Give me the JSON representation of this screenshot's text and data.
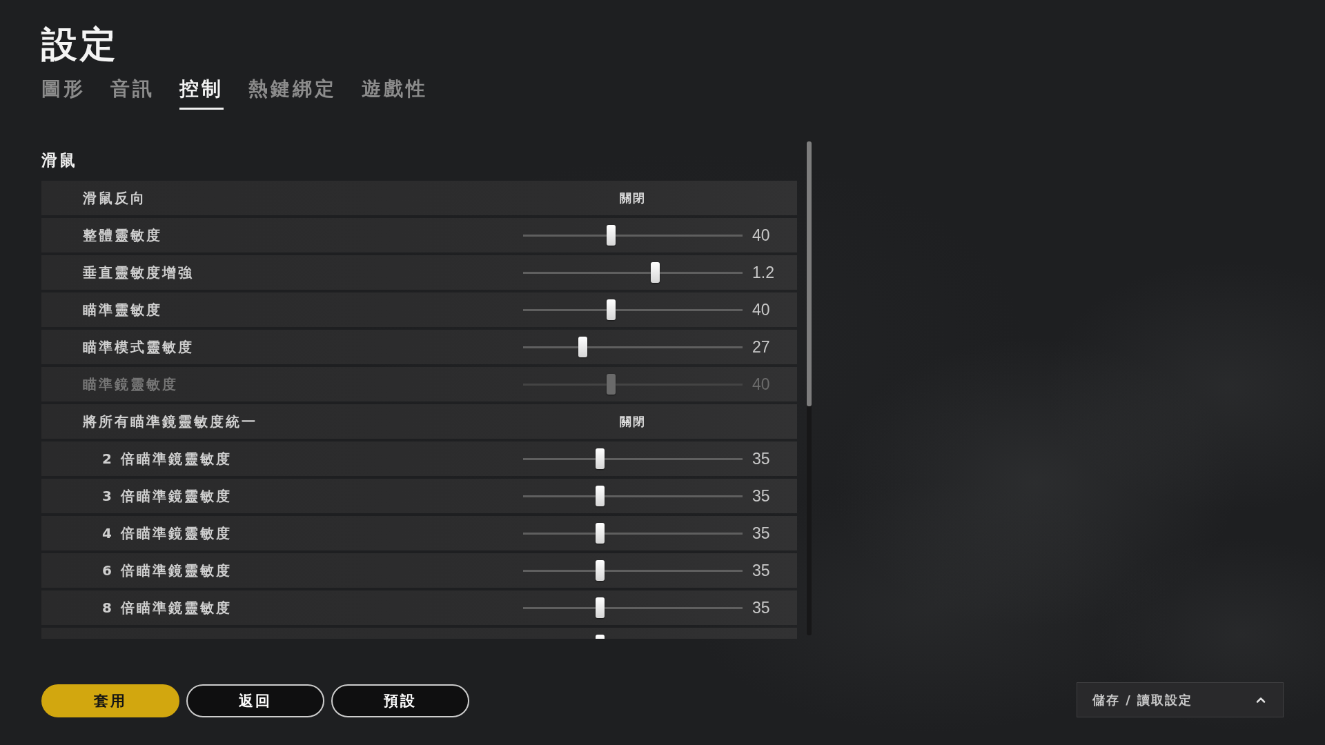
{
  "title": "設定",
  "tabs": [
    {
      "label": "圖形",
      "selected": false
    },
    {
      "label": "音訊",
      "selected": false
    },
    {
      "label": "控制",
      "selected": true
    },
    {
      "label": "熱鍵綁定",
      "selected": false
    },
    {
      "label": "遊戲性",
      "selected": false
    }
  ],
  "section": {
    "title": "滑鼠",
    "rows": [
      {
        "kind": "toggle",
        "label": "滑鼠反向",
        "value": "關閉",
        "disabled": false
      },
      {
        "kind": "slider",
        "label": "整體靈敏度",
        "level": 0.4,
        "value": "40",
        "disabled": false
      },
      {
        "kind": "slider",
        "label": "垂直靈敏度增強",
        "level": 0.6,
        "value": "1.2",
        "disabled": false
      },
      {
        "kind": "slider",
        "label": "瞄準靈敏度",
        "level": 0.4,
        "value": "40",
        "disabled": false
      },
      {
        "kind": "slider",
        "label": "瞄準模式靈敏度",
        "level": 0.27,
        "value": "27",
        "disabled": false
      },
      {
        "kind": "slider",
        "label": "瞄準鏡靈敏度",
        "level": 0.4,
        "value": "40",
        "disabled": true
      },
      {
        "kind": "toggle",
        "label": "將所有瞄準鏡靈敏度統一",
        "value": "關閉",
        "disabled": false,
        "children": [
          {
            "kind": "slider",
            "label": "2 倍瞄準鏡靈敏度",
            "level": 0.35,
            "value": "35",
            "disabled": false
          },
          {
            "kind": "slider",
            "label": "3 倍瞄準鏡靈敏度",
            "level": 0.35,
            "value": "35",
            "disabled": false
          },
          {
            "kind": "slider",
            "label": "4 倍瞄準鏡靈敏度",
            "level": 0.35,
            "value": "35",
            "disabled": false
          },
          {
            "kind": "slider",
            "label": "6 倍瞄準鏡靈敏度",
            "level": 0.35,
            "value": "35",
            "disabled": false
          },
          {
            "kind": "slider",
            "label": "8 倍瞄準鏡靈敏度",
            "level": 0.35,
            "value": "35",
            "disabled": false
          },
          {
            "kind": "slider",
            "level": 0.35,
            "disabled": false
          }
        ]
      }
    ]
  },
  "action_buttons": [
    {
      "label": "套用",
      "kind": "primary"
    },
    {
      "label": "返回",
      "kind": "secondary"
    },
    {
      "label": "預設",
      "kind": "secondary"
    }
  ],
  "profile_menu": {
    "label": "儲存 / 讀取設定"
  }
}
